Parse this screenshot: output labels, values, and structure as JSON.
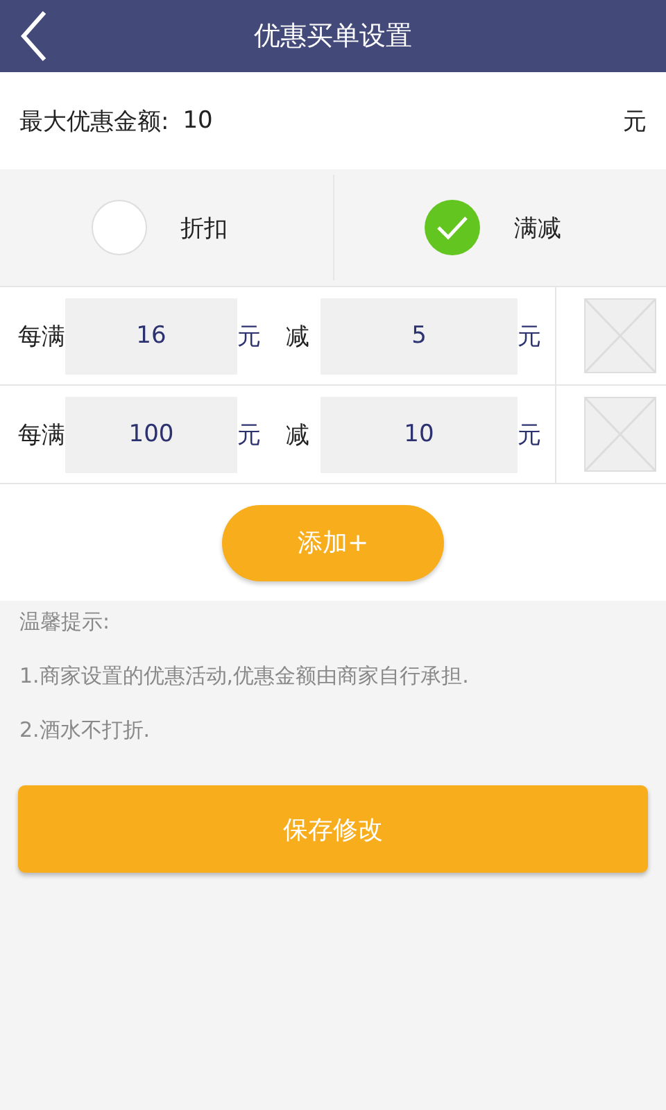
{
  "header": {
    "title": "优惠买单设置"
  },
  "max_discount": {
    "label": "最大优惠金额:",
    "value": "10",
    "unit": "元"
  },
  "modes": [
    {
      "label": "折扣",
      "selected": false
    },
    {
      "label": "满减",
      "selected": true
    }
  ],
  "rules": [
    {
      "prefix": "每满",
      "threshold": "16",
      "unit_1": "元",
      "minus": "减",
      "amount": "5",
      "unit_2": "元"
    },
    {
      "prefix": "每满",
      "threshold": "100",
      "unit_1": "元",
      "minus": "减",
      "amount": "10",
      "unit_2": "元"
    }
  ],
  "add_button": "添加+",
  "tips": {
    "title": "温馨提示:",
    "lines": [
      "1.商家设置的优惠活动,优惠金额由商家自行承担.",
      "2.酒水不打折."
    ]
  },
  "save_button": "保存修改"
}
